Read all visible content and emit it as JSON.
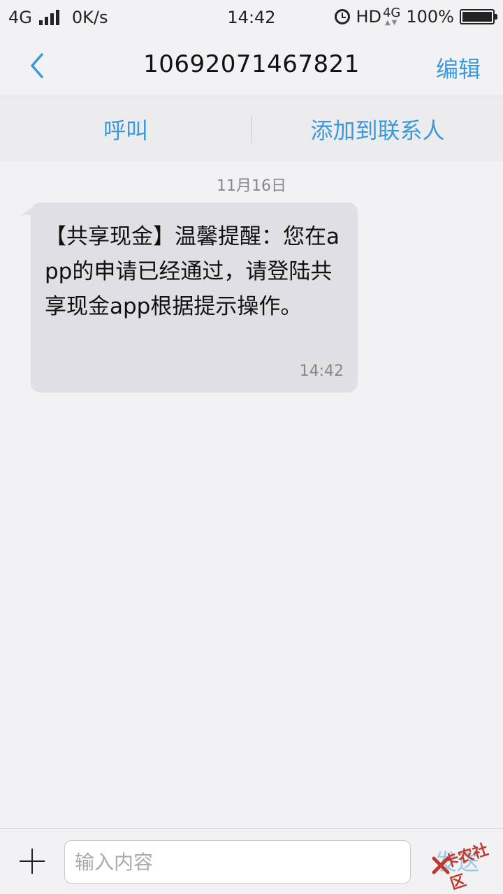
{
  "status_bar": {
    "network": "4G",
    "speed": "0K/s",
    "time": "14:42",
    "hd": "HD",
    "network2": "4G",
    "battery": "100%",
    "battery_fraction": 1.0
  },
  "header": {
    "title": "10692071467821",
    "edit_label": "编辑"
  },
  "actions": {
    "call_label": "呼叫",
    "add_contact_label": "添加到联系人"
  },
  "conversation": {
    "date": "11月16日",
    "messages": [
      {
        "text": "【共享现金】温馨提醒：您在app的申请已经通过，请登陆共享现金app根据提示操作。",
        "time": "14:42"
      }
    ]
  },
  "composer": {
    "placeholder": "输入内容",
    "send_label": "发送"
  },
  "watermark": {
    "text": "卡农社区"
  },
  "colors": {
    "accent": "#3a9ad9",
    "bubble": "#dfdfe4",
    "background": "#f2f2f4"
  }
}
